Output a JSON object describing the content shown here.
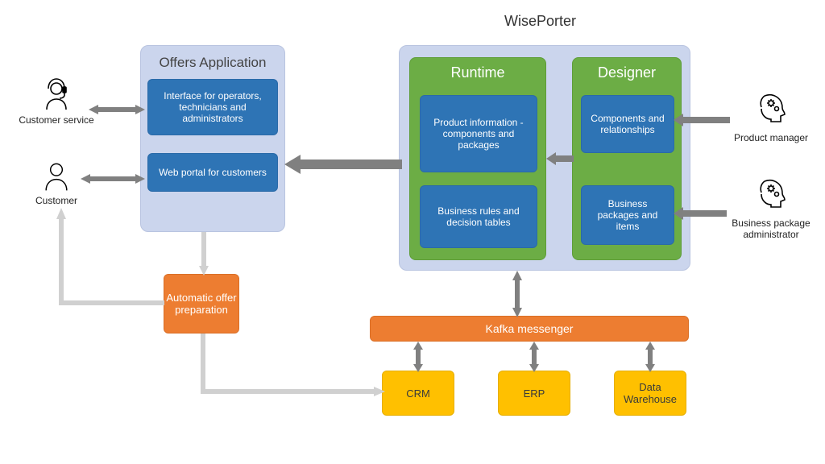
{
  "titles": {
    "wiseporter": "WisePorter",
    "offers": "Offers Application"
  },
  "offers": {
    "interface": "Interface for operators, technicians and administrators",
    "portal": "Web portal for customers"
  },
  "wp": {
    "runtime": {
      "title": "Runtime",
      "product": "Product information - components and packages",
      "rules": "Business rules and decision tables"
    },
    "designer": {
      "title": "Designer",
      "components": "Components and relationships",
      "packages": "Business packages and items"
    }
  },
  "automatic": "Automatic offer preparation",
  "kafka": "Kafka messenger",
  "systems": {
    "crm": "CRM",
    "erp": "ERP",
    "dw": "Data Warehouse"
  },
  "actors": {
    "cs": "Customer service",
    "cust": "Customer",
    "pm": "Product manager",
    "bpa": "Business package administrator"
  },
  "colors": {
    "lavender": "#CBD5ED",
    "green": "#6CAD45",
    "blue": "#2E74B5",
    "orange": "#ED7D31",
    "yellow": "#FFC000",
    "gray": "#808080",
    "lightgray": "#D0D0D0"
  }
}
